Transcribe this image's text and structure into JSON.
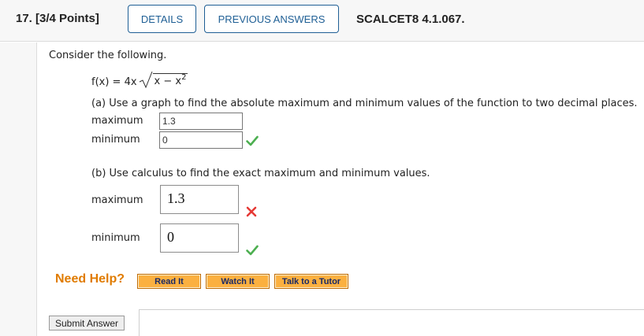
{
  "header": {
    "question_number": "17.",
    "points": "[3/4 Points]",
    "details_label": "DETAILS",
    "previous_answers_label": "PREVIOUS ANSWERS",
    "problem_code": "SCALCET8 4.1.067."
  },
  "problem": {
    "intro": "Consider the following.",
    "formula_lhs": "f(x) = 4x",
    "radicand_var": "x − x",
    "radicand_exp": "2",
    "part_a": {
      "prompt": "(a) Use a graph to find the absolute maximum and minimum values of the function to two decimal places.",
      "maximum_label": "maximum",
      "maximum_value": "1.3",
      "maximum_status": "none",
      "minimum_label": "minimum",
      "minimum_value": "0",
      "minimum_status": "correct"
    },
    "part_b": {
      "prompt": "(b) Use calculus to find the exact maximum and minimum values.",
      "maximum_label": "maximum",
      "maximum_value": "1.3",
      "maximum_status": "incorrect",
      "minimum_label": "minimum",
      "minimum_value": "0",
      "minimum_status": "correct"
    }
  },
  "help": {
    "label": "Need Help?",
    "read_it": "Read It",
    "watch_it": "Watch It",
    "talk_to_tutor": "Talk to a Tutor"
  },
  "submit_label": "Submit Answer",
  "colors": {
    "accent_blue": "#1f5f95",
    "help_orange": "#e07b00",
    "help_button": "#fbb040",
    "check_green": "#4caf50",
    "cross_red": "#e53935"
  }
}
